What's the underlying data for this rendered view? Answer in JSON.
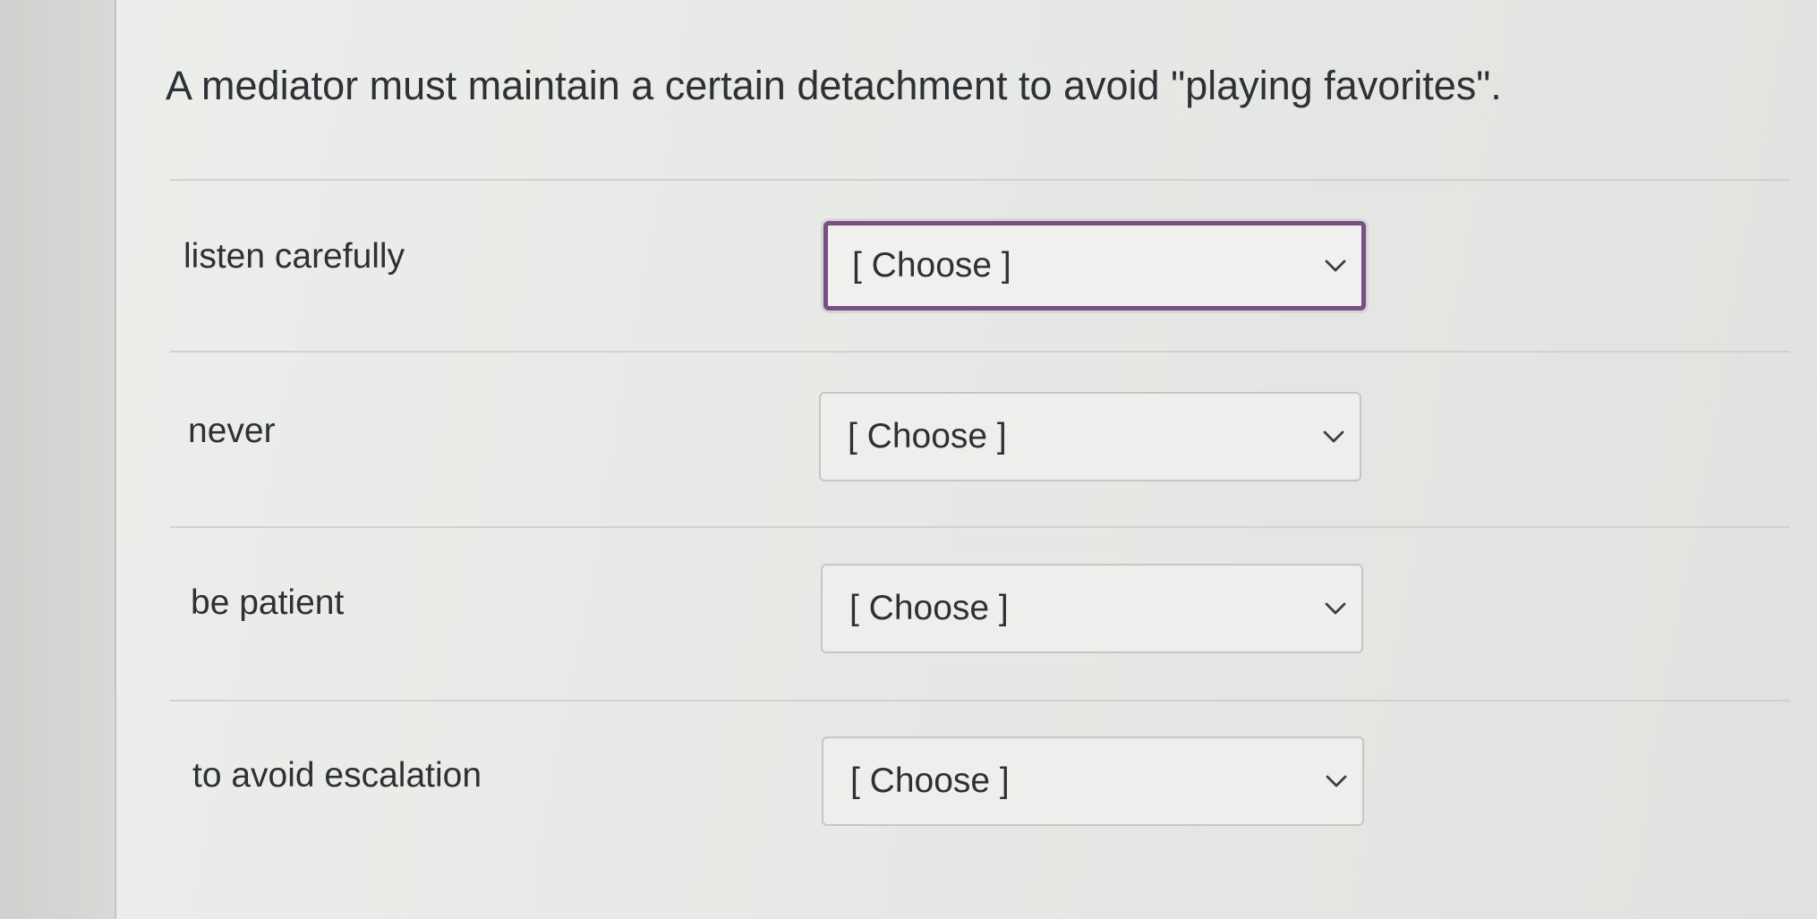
{
  "question": {
    "text": "A mediator must maintain a certain detachment to avoid \"playing favorites\"."
  },
  "rows": [
    {
      "label": "listen carefully",
      "selected": "[ Choose ]",
      "focused": true
    },
    {
      "label": "never",
      "selected": "[ Choose ]",
      "focused": false
    },
    {
      "label": "be patient",
      "selected": "[ Choose ]",
      "focused": false
    },
    {
      "label": "to avoid escalation",
      "selected": "[ Choose ]",
      "focused": false
    }
  ],
  "icons": {
    "dropdown": "chevron-down-icon"
  },
  "colors": {
    "focus_border": "#7a4f86",
    "text": "#2d3135"
  }
}
